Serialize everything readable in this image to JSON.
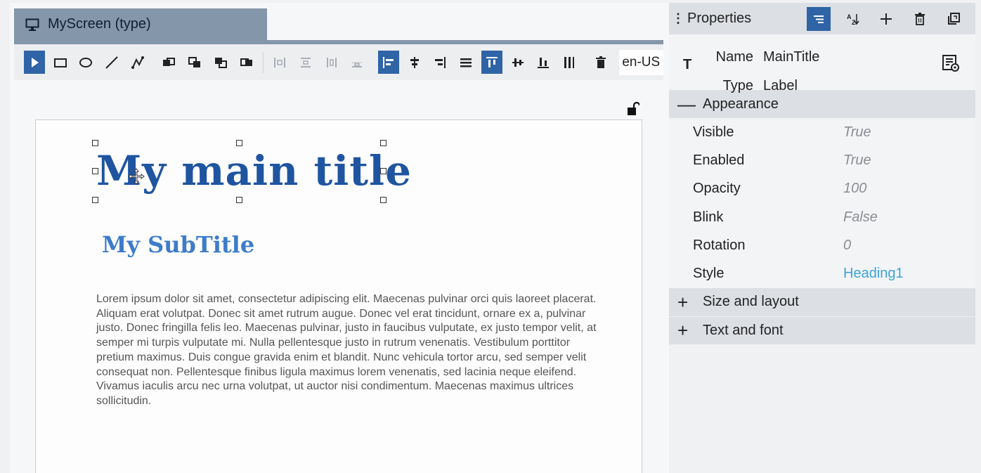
{
  "editor": {
    "tab_title": "MyScreen (type)",
    "locale": "en-US",
    "toolbar": [
      {
        "icon": "pointer-icon",
        "active": true
      },
      {
        "icon": "rectangle-icon"
      },
      {
        "icon": "ellipse-icon"
      },
      {
        "icon": "line-icon"
      },
      {
        "icon": "polyline-icon"
      },
      {
        "icon": "bring-forward-icon"
      },
      {
        "icon": "bring-to-front-icon"
      },
      {
        "icon": "send-to-back-icon"
      },
      {
        "icon": "send-backward-icon"
      },
      {
        "icon": "distribute-horizontal-icon",
        "disabled": true
      },
      {
        "icon": "distribute-center-icon",
        "disabled": true
      },
      {
        "icon": "distribute-vertical-icon",
        "disabled": true
      },
      {
        "icon": "distribute-bottom-icon",
        "disabled": true
      },
      {
        "icon": "align-left-icon",
        "active": true
      },
      {
        "icon": "align-center-icon"
      },
      {
        "icon": "align-right-icon"
      },
      {
        "icon": "justify-icon"
      },
      {
        "icon": "align-top-icon",
        "active": true
      },
      {
        "icon": "align-middle-icon"
      },
      {
        "icon": "align-bottom-icon"
      },
      {
        "icon": "stretch-icon"
      },
      {
        "icon": "delete-icon"
      }
    ],
    "canvas": {
      "main_title": "My main title",
      "sub_title": "My SubTitle",
      "body_text": "Lorem ipsum dolor sit amet, consectetur adipiscing elit. Maecenas pulvinar orci quis laoreet placerat. Aliquam erat volutpat. Donec sit amet rutrum augue. Donec vel erat tincidunt, ornare ex a, pulvinar justo. Donec fringilla felis leo. Maecenas pulvinar, justo in faucibus vulputate, ex justo tempor velit, at semper mi turpis vulputate mi. Nulla pellentesque justo in rutrum venenatis. Vestibulum porttitor pretium maximus. Duis congue gravida enim et blandit. Nunc vehicula tortor arcu, sed semper velit consequat non. Pellentesque finibus ligula maximus lorem venenatis, sed lacinia neque eleifend. Vivamus iaculis arcu nec urna volutpat, ut auctor nisi condimentum. Maecenas maximus ultrices sollicitudin."
    }
  },
  "properties": {
    "title": "Properties",
    "name_label": "Name",
    "name_value": "MainTitle",
    "type_label": "Type",
    "type_value": "Label",
    "sections": {
      "appearance": "Appearance",
      "size_layout": "Size and layout",
      "text_font": "Text and font"
    },
    "appearance_rows": [
      {
        "key": "Visible",
        "value": "True"
      },
      {
        "key": "Enabled",
        "value": "True"
      },
      {
        "key": "Opacity",
        "value": "100"
      },
      {
        "key": "Blink",
        "value": "False"
      },
      {
        "key": "Rotation",
        "value": "0"
      },
      {
        "key": "Style",
        "value": "Heading1"
      }
    ],
    "colors": {
      "accent": "#2f64a6",
      "link": "#3aa5dc",
      "title": "#1f55a0",
      "subtitle": "#3d7cc9"
    }
  }
}
